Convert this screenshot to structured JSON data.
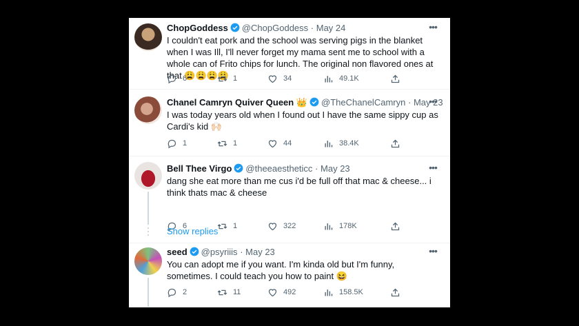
{
  "colors": {
    "accent": "#1d9bf0",
    "verified": "#1d9bf0",
    "gold_badge": "#f7b92a",
    "muted": "#536471",
    "text": "#0f1419"
  },
  "tweets": [
    {
      "name": "ChopGoddess",
      "handle": "@ChopGoddess",
      "sep": "·",
      "date": "May 24",
      "text": "I couldn't eat pork and the school was serving pigs in the blanket when I was Ill, I'll never forget my mama sent me to school with a whole can of Frito chips for lunch. The original non flavored ones at that 😩😩😩😩",
      "replies": "6",
      "retweets": "1",
      "likes": "34",
      "views": "49.1K",
      "icons": [
        "reply-icon",
        "retweet-icon",
        "like-icon",
        "views-icon",
        "share-icon"
      ]
    },
    {
      "name": "Chanel Camryn Quiver Queen 👑",
      "handle": "@TheChanelCamryn",
      "sep": "·",
      "date": "May 23",
      "text": "I was today years old when I found out I have the same sippy cup as Cardi's kid 🙌🏻",
      "replies": "1",
      "retweets": "1",
      "likes": "44",
      "views": "38.4K"
    },
    {
      "name": "Bell Thee Virgo",
      "handle": "@theeaestheticc",
      "sep": "·",
      "date": "May 23",
      "text": "dang she eat more than me cus i'd be full off that mac & cheese... i think thats mac & cheese",
      "replies": "6",
      "retweets": "1",
      "likes": "322",
      "views": "178K"
    },
    {
      "name": "seed",
      "handle": "@psyriiis",
      "sep": "·",
      "date": "May 23",
      "text": "You can adopt me if you want. I'm kinda old but I'm funny, sometimes. I could teach you how to paint 😆",
      "replies": "2",
      "retweets": "11",
      "likes": "492",
      "views": "158.5K"
    }
  ],
  "show_replies": "Show replies",
  "more_glyph": "•••"
}
